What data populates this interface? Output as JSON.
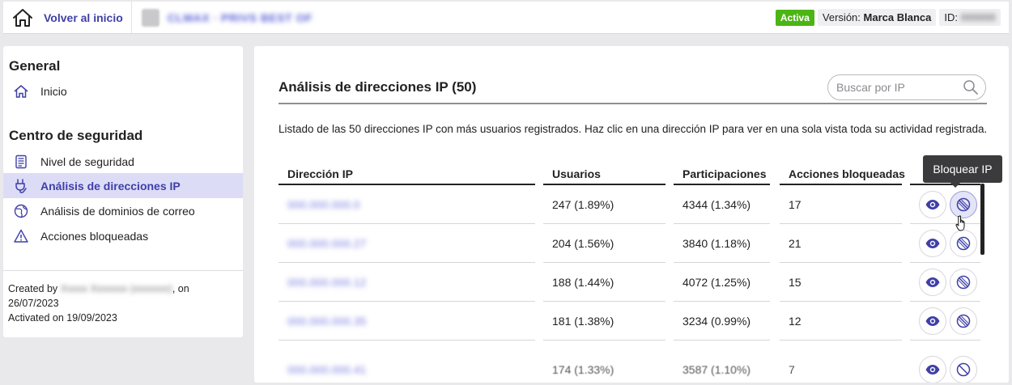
{
  "header": {
    "home_label": "Volver al inicio",
    "status_badge": "Activa",
    "version_label": "Versión:",
    "version_value": "Marca Blanca",
    "id_label": "ID:",
    "colors": {
      "accent": "#3f3fa8",
      "active": "#4cb515"
    }
  },
  "sidebar": {
    "section_general": "General",
    "item_inicio": "Inicio",
    "section_security": "Centro de seguridad",
    "item_nivel": "Nivel de seguridad",
    "item_analisis_ip": "Análisis de direcciones IP",
    "item_dominios": "Análisis de dominios de correo",
    "item_acciones": "Acciones bloqueadas",
    "active_item": "Análisis de direcciones IP",
    "footer": {
      "created_prefix": "Created by",
      "created_suffix": ", on",
      "created_date": "26/07/2023",
      "activated": "Activated on 19/09/2023"
    }
  },
  "main": {
    "title": "Análisis de direcciones IP (50)",
    "search_placeholder": "Buscar por IP",
    "description": "Listado de las 50 direcciones IP con más usuarios registrados. Haz clic en una dirección IP para ver en una sola vista toda su actividad registrada.",
    "columns": {
      "ip": "Dirección IP",
      "users": "Usuarios",
      "participations": "Participaciones",
      "blocked": "Acciones bloqueadas"
    },
    "tooltip": "Bloquear IP",
    "rows": [
      {
        "users": "247 (1.89%)",
        "participations": "4344 (1.34%)",
        "blocked": "17"
      },
      {
        "users": "204 (1.56%)",
        "participations": "3840 (1.18%)",
        "blocked": "21"
      },
      {
        "users": "188 (1.44%)",
        "participations": "4072 (1.25%)",
        "blocked": "15"
      },
      {
        "users": "181 (1.38%)",
        "participations": "3234 (0.99%)",
        "blocked": "12"
      }
    ]
  },
  "icons": [
    "home-icon",
    "search-icon",
    "checklist-icon",
    "shield-plug-icon",
    "globe-icon",
    "warning-icon",
    "eye-icon",
    "block-icon",
    "hand-cursor-icon"
  ]
}
